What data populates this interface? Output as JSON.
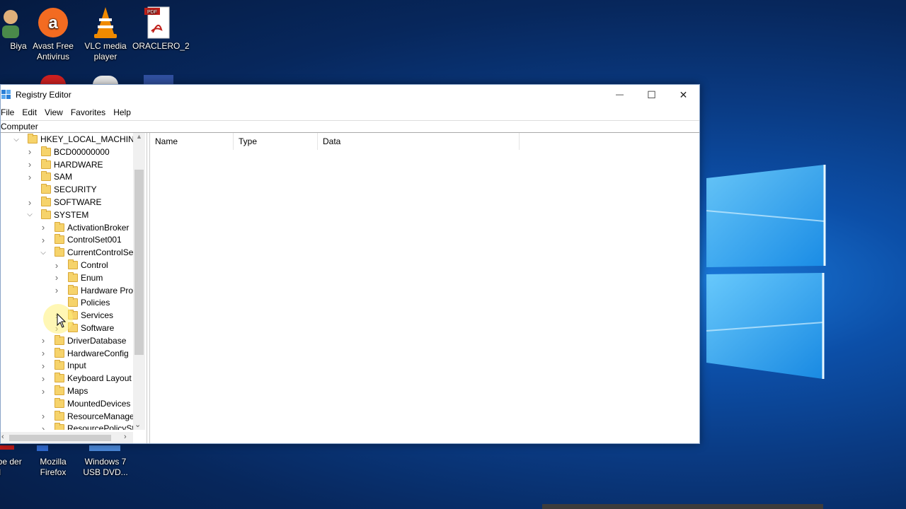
{
  "desktop": {
    "icons_top": [
      {
        "label": "Biya",
        "icon": "user-icon"
      },
      {
        "label": "Avast Free Antivirus",
        "icon": "avast-icon"
      },
      {
        "label": "VLC media player",
        "icon": "vlc-cone-icon"
      },
      {
        "label": "ORACLERO_2",
        "icon": "pdf-icon"
      }
    ],
    "icons_bottom": [
      {
        "label": "obe der XI",
        "icon": "adobe-reader-icon"
      },
      {
        "label": "Mozilla Firefox",
        "icon": "firefox-icon"
      },
      {
        "label": "Windows 7 USB DVD...",
        "icon": "usb-dvd-tool-icon"
      }
    ],
    "colors": {
      "background": "#0a3a82",
      "logo": "#3fb2f5"
    }
  },
  "window": {
    "title": "Registry Editor",
    "controls": {
      "minimize": "—",
      "maximize": "☐",
      "close": "✕"
    },
    "menu": [
      "File",
      "Edit",
      "View",
      "Favorites",
      "Help"
    ],
    "address": "Computer",
    "tree": [
      {
        "label": "HKEY_LOCAL_MACHINE",
        "level": 0,
        "expander": "open"
      },
      {
        "label": "BCD00000000",
        "level": 1,
        "expander": "closed"
      },
      {
        "label": "HARDWARE",
        "level": 1,
        "expander": "closed"
      },
      {
        "label": "SAM",
        "level": 1,
        "expander": "closed"
      },
      {
        "label": "SECURITY",
        "level": 1,
        "expander": "none"
      },
      {
        "label": "SOFTWARE",
        "level": 1,
        "expander": "closed"
      },
      {
        "label": "SYSTEM",
        "level": 1,
        "expander": "open"
      },
      {
        "label": "ActivationBroker",
        "level": 2,
        "expander": "closed"
      },
      {
        "label": "ControlSet001",
        "level": 2,
        "expander": "closed"
      },
      {
        "label": "CurrentControlSet",
        "level": 2,
        "expander": "open"
      },
      {
        "label": "Control",
        "level": 3,
        "expander": "closed"
      },
      {
        "label": "Enum",
        "level": 3,
        "expander": "closed"
      },
      {
        "label": "Hardware Prof",
        "level": 3,
        "expander": "closed"
      },
      {
        "label": "Policies",
        "level": 3,
        "expander": "none"
      },
      {
        "label": "Services",
        "level": 3,
        "expander": "closed"
      },
      {
        "label": "Software",
        "level": 3,
        "expander": "closed"
      },
      {
        "label": "DriverDatabase",
        "level": 2,
        "expander": "closed"
      },
      {
        "label": "HardwareConfig",
        "level": 2,
        "expander": "closed"
      },
      {
        "label": "Input",
        "level": 2,
        "expander": "closed"
      },
      {
        "label": "Keyboard Layout",
        "level": 2,
        "expander": "closed"
      },
      {
        "label": "Maps",
        "level": 2,
        "expander": "closed"
      },
      {
        "label": "MountedDevices",
        "level": 2,
        "expander": "none"
      },
      {
        "label": "ResourceManager",
        "level": 2,
        "expander": "closed"
      },
      {
        "label": "ResourcePolicySto",
        "level": 2,
        "expander": "closed"
      }
    ],
    "columns": [
      "Name",
      "Type",
      "Data"
    ]
  }
}
